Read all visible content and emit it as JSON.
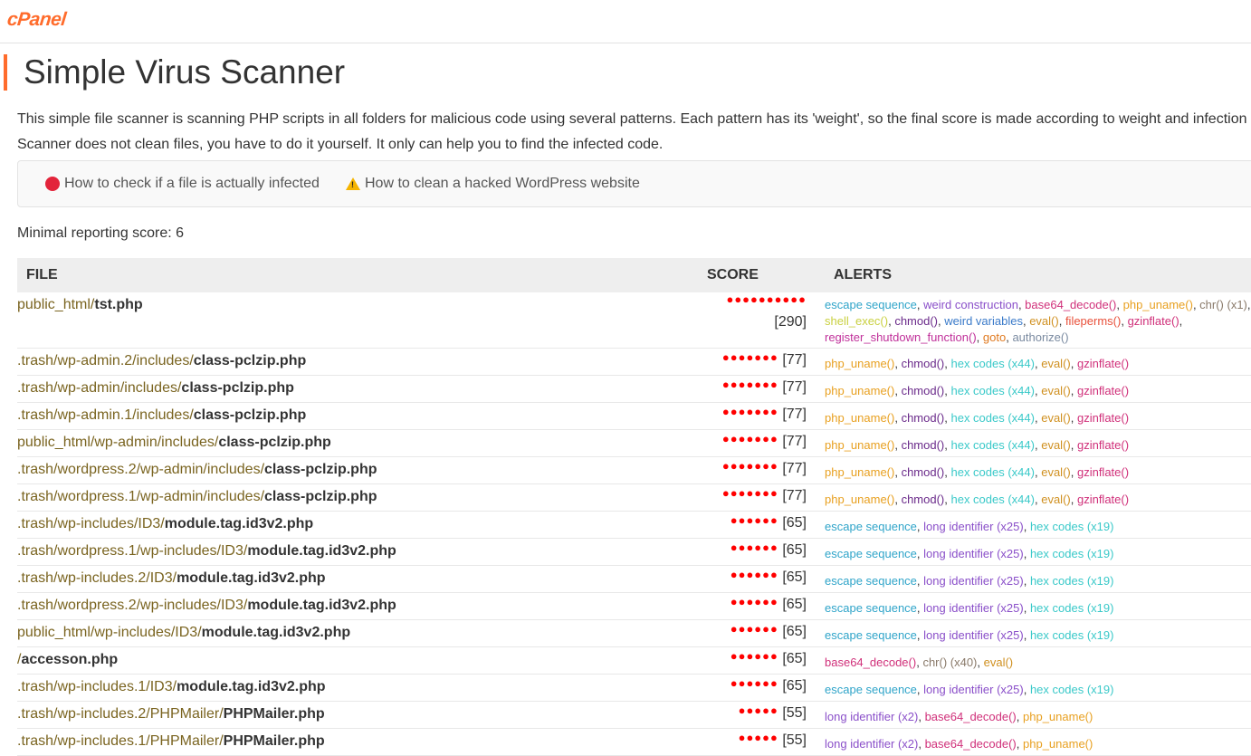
{
  "header": {
    "logo": "cPanel",
    "page_title": "Simple Virus Scanner"
  },
  "intro": {
    "line1": "This simple file scanner is scanning PHP scripts in all folders for malicious code using several patterns. Each pattern has its 'weight', so the final score is made according to weight and infection",
    "line2": "Scanner does not clean files, you have to do it yourself. It only can help you to find the infected code."
  },
  "links": {
    "check_infected": "How to check if a file is actually infected",
    "clean_hacked": "How to clean a hacked WordPress website"
  },
  "min_score_text": "Minimal reporting score: 6",
  "table": {
    "headers": {
      "file": "FILE",
      "score": "SCORE",
      "alerts": "ALERTS"
    },
    "rows": [
      {
        "path": "public_html/",
        "file": "tst.php",
        "dots": "●●●●●●●●●●",
        "score": "[290]",
        "alerts": [
          {
            "t": "escape sequence",
            "c": "#2fa4c9"
          },
          {
            "t": "weird construction",
            "c": "#8a4fc9"
          },
          {
            "t": "base64_decode()",
            "c": "#d0307a"
          },
          {
            "t": "php_uname()",
            "c": "#e8a020"
          },
          {
            "t": "chr() (x1)",
            "c": "#8a7a6a"
          },
          {
            "t": "shell_exec()",
            "c": "#c9d040"
          },
          {
            "t": "chmod()",
            "c": "#6a2a8a"
          },
          {
            "t": "weird variables",
            "c": "#3a7ac9"
          },
          {
            "t": "eval()",
            "c": "#d09020"
          },
          {
            "t": "fileperms()",
            "c": "#e8503a"
          },
          {
            "t": "gzinflate()",
            "c": "#d0307a"
          },
          {
            "t": "register_shutdown_function()",
            "c": "#c0309a"
          },
          {
            "t": "goto",
            "c": "#e07a20"
          },
          {
            "t": "authorize()",
            "c": "#7a8aa0"
          }
        ]
      },
      {
        "path": ".trash/wp-admin.2/includes/",
        "file": "class-pclzip.php",
        "dots": "●●●●●●●",
        "score": "[77]",
        "alerts": [
          {
            "t": "php_uname()",
            "c": "#e8a020"
          },
          {
            "t": "chmod()",
            "c": "#6a2a8a"
          },
          {
            "t": "hex codes (x44)",
            "c": "#3ac9c9"
          },
          {
            "t": "eval()",
            "c": "#d09020"
          },
          {
            "t": "gzinflate()",
            "c": "#d0307a"
          }
        ]
      },
      {
        "path": ".trash/wp-admin/includes/",
        "file": "class-pclzip.php",
        "dots": "●●●●●●●",
        "score": "[77]",
        "alerts": [
          {
            "t": "php_uname()",
            "c": "#e8a020"
          },
          {
            "t": "chmod()",
            "c": "#6a2a8a"
          },
          {
            "t": "hex codes (x44)",
            "c": "#3ac9c9"
          },
          {
            "t": "eval()",
            "c": "#d09020"
          },
          {
            "t": "gzinflate()",
            "c": "#d0307a"
          }
        ]
      },
      {
        "path": ".trash/wp-admin.1/includes/",
        "file": "class-pclzip.php",
        "dots": "●●●●●●●",
        "score": "[77]",
        "alerts": [
          {
            "t": "php_uname()",
            "c": "#e8a020"
          },
          {
            "t": "chmod()",
            "c": "#6a2a8a"
          },
          {
            "t": "hex codes (x44)",
            "c": "#3ac9c9"
          },
          {
            "t": "eval()",
            "c": "#d09020"
          },
          {
            "t": "gzinflate()",
            "c": "#d0307a"
          }
        ]
      },
      {
        "path": "public_html/wp-admin/includes/",
        "file": "class-pclzip.php",
        "dots": "●●●●●●●",
        "score": "[77]",
        "alerts": [
          {
            "t": "php_uname()",
            "c": "#e8a020"
          },
          {
            "t": "chmod()",
            "c": "#6a2a8a"
          },
          {
            "t": "hex codes (x44)",
            "c": "#3ac9c9"
          },
          {
            "t": "eval()",
            "c": "#d09020"
          },
          {
            "t": "gzinflate()",
            "c": "#d0307a"
          }
        ]
      },
      {
        "path": ".trash/wordpress.2/wp-admin/includes/",
        "file": "class-pclzip.php",
        "dots": "●●●●●●●",
        "score": "[77]",
        "alerts": [
          {
            "t": "php_uname()",
            "c": "#e8a020"
          },
          {
            "t": "chmod()",
            "c": "#6a2a8a"
          },
          {
            "t": "hex codes (x44)",
            "c": "#3ac9c9"
          },
          {
            "t": "eval()",
            "c": "#d09020"
          },
          {
            "t": "gzinflate()",
            "c": "#d0307a"
          }
        ]
      },
      {
        "path": ".trash/wordpress.1/wp-admin/includes/",
        "file": "class-pclzip.php",
        "dots": "●●●●●●●",
        "score": "[77]",
        "alerts": [
          {
            "t": "php_uname()",
            "c": "#e8a020"
          },
          {
            "t": "chmod()",
            "c": "#6a2a8a"
          },
          {
            "t": "hex codes (x44)",
            "c": "#3ac9c9"
          },
          {
            "t": "eval()",
            "c": "#d09020"
          },
          {
            "t": "gzinflate()",
            "c": "#d0307a"
          }
        ]
      },
      {
        "path": ".trash/wp-includes/ID3/",
        "file": "module.tag.id3v2.php",
        "dots": "●●●●●●",
        "score": "[65]",
        "alerts": [
          {
            "t": "escape sequence",
            "c": "#2fa4c9"
          },
          {
            "t": "long identifier (x25)",
            "c": "#8a4fc9"
          },
          {
            "t": "hex codes (x19)",
            "c": "#3ac9c9"
          }
        ]
      },
      {
        "path": ".trash/wordpress.1/wp-includes/ID3/",
        "file": "module.tag.id3v2.php",
        "dots": "●●●●●●",
        "score": "[65]",
        "alerts": [
          {
            "t": "escape sequence",
            "c": "#2fa4c9"
          },
          {
            "t": "long identifier (x25)",
            "c": "#8a4fc9"
          },
          {
            "t": "hex codes (x19)",
            "c": "#3ac9c9"
          }
        ]
      },
      {
        "path": ".trash/wp-includes.2/ID3/",
        "file": "module.tag.id3v2.php",
        "dots": "●●●●●●",
        "score": "[65]",
        "alerts": [
          {
            "t": "escape sequence",
            "c": "#2fa4c9"
          },
          {
            "t": "long identifier (x25)",
            "c": "#8a4fc9"
          },
          {
            "t": "hex codes (x19)",
            "c": "#3ac9c9"
          }
        ]
      },
      {
        "path": ".trash/wordpress.2/wp-includes/ID3/",
        "file": "module.tag.id3v2.php",
        "dots": "●●●●●●",
        "score": "[65]",
        "alerts": [
          {
            "t": "escape sequence",
            "c": "#2fa4c9"
          },
          {
            "t": "long identifier (x25)",
            "c": "#8a4fc9"
          },
          {
            "t": "hex codes (x19)",
            "c": "#3ac9c9"
          }
        ]
      },
      {
        "path": "public_html/wp-includes/ID3/",
        "file": "module.tag.id3v2.php",
        "dots": "●●●●●●",
        "score": "[65]",
        "alerts": [
          {
            "t": "escape sequence",
            "c": "#2fa4c9"
          },
          {
            "t": "long identifier (x25)",
            "c": "#8a4fc9"
          },
          {
            "t": "hex codes (x19)",
            "c": "#3ac9c9"
          }
        ]
      },
      {
        "path": "/",
        "file": "accesson.php",
        "dots": "●●●●●●",
        "score": "[65]",
        "alerts": [
          {
            "t": "base64_decode()",
            "c": "#d0307a"
          },
          {
            "t": "chr() (x40)",
            "c": "#8a7a6a"
          },
          {
            "t": "eval()",
            "c": "#d09020"
          }
        ]
      },
      {
        "path": ".trash/wp-includes.1/ID3/",
        "file": "module.tag.id3v2.php",
        "dots": "●●●●●●",
        "score": "[65]",
        "alerts": [
          {
            "t": "escape sequence",
            "c": "#2fa4c9"
          },
          {
            "t": "long identifier (x25)",
            "c": "#8a4fc9"
          },
          {
            "t": "hex codes (x19)",
            "c": "#3ac9c9"
          }
        ]
      },
      {
        "path": ".trash/wp-includes.2/PHPMailer/",
        "file": "PHPMailer.php",
        "dots": "●●●●●",
        "score": "[55]",
        "alerts": [
          {
            "t": "long identifier (x2)",
            "c": "#8a4fc9"
          },
          {
            "t": "base64_decode()",
            "c": "#d0307a"
          },
          {
            "t": "php_uname()",
            "c": "#e8a020"
          }
        ]
      },
      {
        "path": ".trash/wp-includes.1/PHPMailer/",
        "file": "PHPMailer.php",
        "dots": "●●●●●",
        "score": "[55]",
        "alerts": [
          {
            "t": "long identifier (x2)",
            "c": "#8a4fc9"
          },
          {
            "t": "base64_decode()",
            "c": "#d0307a"
          },
          {
            "t": "php_uname()",
            "c": "#e8a020"
          }
        ]
      }
    ]
  }
}
